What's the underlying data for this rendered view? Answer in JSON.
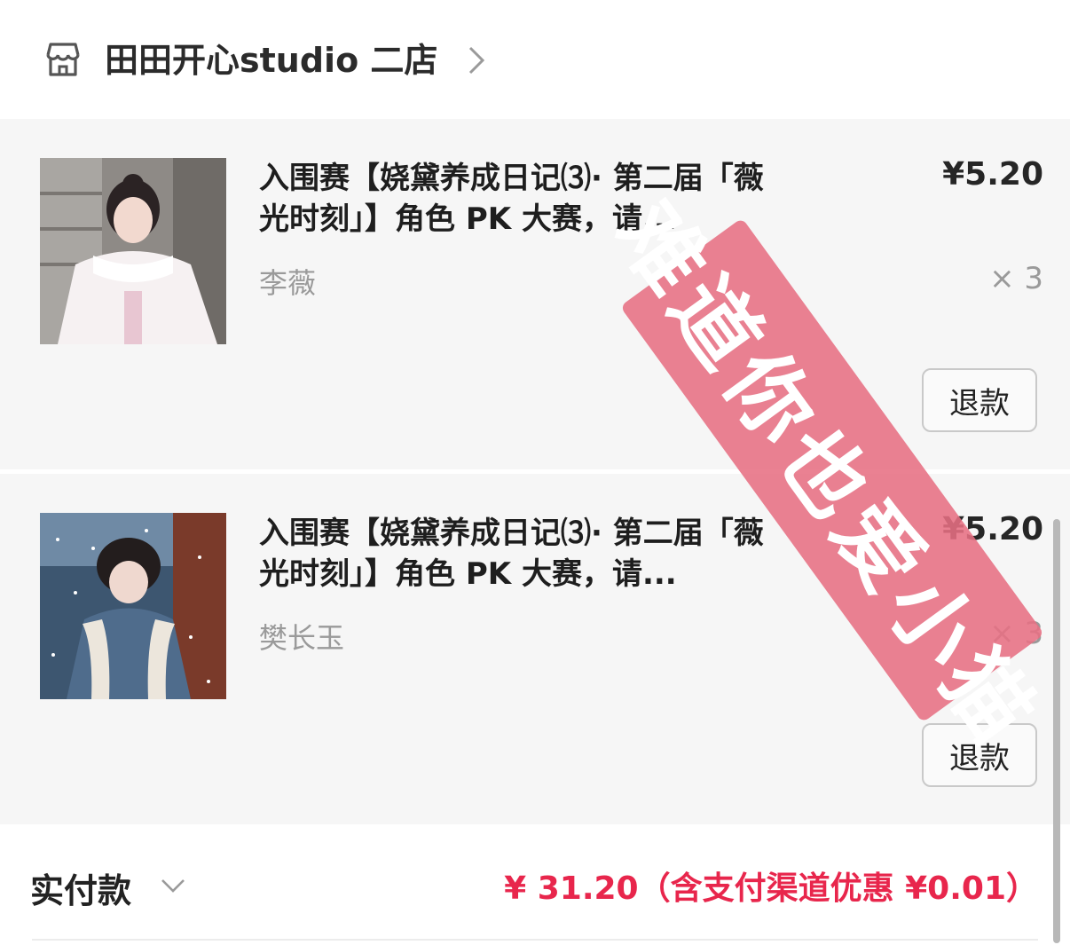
{
  "store": {
    "name": "田田开心studio 二店",
    "icon": "store-icon",
    "chevron_icon": "chevron-right-icon"
  },
  "items": [
    {
      "title": "入围赛【娆黛养成日记⑶· 第二届「薇光时刻」】角色 PK 大赛，请...",
      "spec": "李薇",
      "price": "¥5.20",
      "quantity": "× 3",
      "refund_label": "退款"
    },
    {
      "title": "入围赛【娆黛养成日记⑶· 第二届「薇光时刻」】角色 PK 大赛，请...",
      "spec": "樊长玉",
      "price": "¥5.20",
      "quantity": "× 3",
      "refund_label": "退款"
    }
  ],
  "payment": {
    "label": "实付款",
    "amount": "¥ 31.20（含支付渠道优惠 ¥0.01）"
  },
  "watermark": {
    "text": "难道你也爱小猫"
  },
  "colors": {
    "accent": "#e8264c",
    "stamp": "#e77083",
    "card_bg": "#f6f6f6"
  }
}
